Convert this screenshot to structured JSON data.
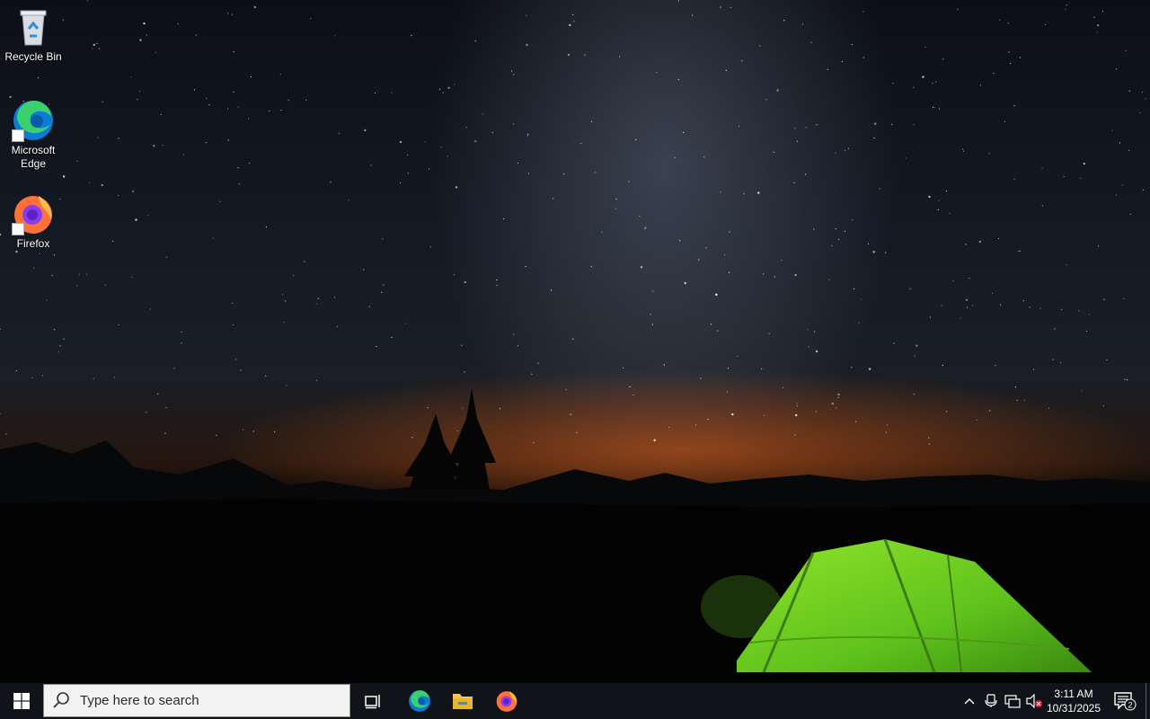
{
  "desktop": {
    "icons": [
      {
        "label": "Recycle Bin",
        "icon": "recycle-bin-icon"
      },
      {
        "label": "Microsoft\nEdge",
        "icon": "edge-icon"
      },
      {
        "label": "Firefox",
        "icon": "firefox-icon"
      }
    ],
    "wallpaper": "night-sky-milky-way-green-tent"
  },
  "taskbar": {
    "start_icon": "windows-logo-icon",
    "search": {
      "placeholder": "Type here to search",
      "icon": "search-icon"
    },
    "pinned": [
      {
        "name": "task-view",
        "icon": "task-view-icon"
      },
      {
        "name": "edge",
        "icon": "edge-icon"
      },
      {
        "name": "file-explorer",
        "icon": "folder-icon"
      },
      {
        "name": "firefox",
        "icon": "firefox-icon"
      }
    ],
    "tray": {
      "icons": [
        "chevron-up-icon",
        "meet-now-icon",
        "network-icon",
        "volume-muted-icon"
      ],
      "time": "3:11 AM",
      "date": "10/31/2025",
      "notification_count": "2"
    }
  },
  "colors": {
    "taskbar_bg": "#101317",
    "search_bg": "#f3f3f3",
    "edge_blue": "#0c7bd6",
    "edge_green": "#3ccf6d",
    "firefox_orange": "#ff7139",
    "firefox_purple": "#8a3cf0",
    "folder_yellow": "#f2c94c",
    "windows_logo": "#ffffff"
  }
}
